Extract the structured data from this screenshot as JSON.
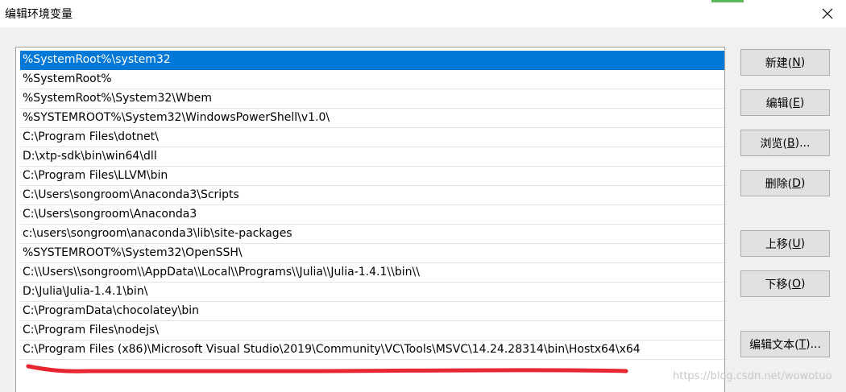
{
  "window": {
    "title": "编辑环境变量"
  },
  "paths": [
    "%SystemRoot%\\system32",
    "%SystemRoot%",
    "%SystemRoot%\\System32\\Wbem",
    "%SYSTEMROOT%\\System32\\WindowsPowerShell\\v1.0\\",
    "C:\\Program Files\\dotnet\\",
    "D:\\xtp-sdk\\bin\\win64\\dll",
    "C:\\Program Files\\LLVM\\bin",
    "C:\\Users\\songroom\\Anaconda3\\Scripts",
    "C:\\Users\\songroom\\Anaconda3",
    "c:\\users\\songroom\\anaconda3\\lib\\site-packages",
    "%SYSTEMROOT%\\System32\\OpenSSH\\",
    "C:\\\\Users\\\\songroom\\\\AppData\\\\Local\\\\Programs\\\\Julia\\\\Julia-1.4.1\\\\bin\\\\",
    "D:\\Julia\\Julia-1.4.1\\bin\\",
    "C:\\ProgramData\\chocolatey\\bin",
    "C:\\Program Files\\nodejs\\",
    "C:\\Program Files (x86)\\Microsoft Visual Studio\\2019\\Community\\VC\\Tools\\MSVC\\14.24.28314\\bin\\Hostx64\\x64"
  ],
  "selected_index": 0,
  "buttons": {
    "new": {
      "label": "新建(",
      "key": "N",
      "suffix": ")"
    },
    "edit": {
      "label": "编辑(",
      "key": "E",
      "suffix": ")"
    },
    "browse": {
      "label": "浏览(",
      "key": "B",
      "suffix": ")..."
    },
    "delete": {
      "label": "删除(",
      "key": "D",
      "suffix": ")"
    },
    "move_up": {
      "label": "上移(",
      "key": "U",
      "suffix": ")"
    },
    "move_down": {
      "label": "下移(",
      "key": "O",
      "suffix": ")"
    },
    "edit_text": {
      "label": "编辑文本(",
      "key": "T",
      "suffix": ")..."
    }
  },
  "watermark": "https://blog.csdn.net/wowotuo",
  "colors": {
    "selection": "#0078d7",
    "annotation": "#e8262f"
  }
}
